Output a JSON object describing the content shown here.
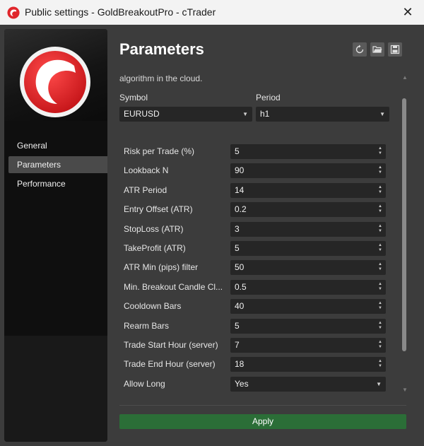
{
  "window": {
    "title": "Public settings - GoldBreakoutPro - cTrader",
    "close_glyph": "✕",
    "logo_icon": "ctrader-logo-icon"
  },
  "sidebar": {
    "items": [
      {
        "label": "General",
        "active": false
      },
      {
        "label": "Parameters",
        "active": true
      },
      {
        "label": "Performance",
        "active": false
      }
    ]
  },
  "main": {
    "title": "Parameters",
    "toolbar": {
      "icons": [
        "reset-icon",
        "open-folder-icon",
        "save-icon"
      ]
    },
    "partial_text": "algorithm in the cloud.",
    "symbol": {
      "label": "Symbol",
      "value": "EURUSD"
    },
    "period": {
      "label": "Period",
      "value": "h1"
    },
    "params": [
      {
        "label": "Risk per Trade (%)",
        "value": "5",
        "type": "number"
      },
      {
        "label": "Lookback N",
        "value": "90",
        "type": "number"
      },
      {
        "label": "ATR Period",
        "value": "14",
        "type": "number"
      },
      {
        "label": "Entry Offset (ATR)",
        "value": "0.2",
        "type": "number"
      },
      {
        "label": "StopLoss (ATR)",
        "value": "3",
        "type": "number"
      },
      {
        "label": "TakeProfit (ATR)",
        "value": "5",
        "type": "number"
      },
      {
        "label": "ATR Min (pips) filter",
        "value": "50",
        "type": "number"
      },
      {
        "label": "Min. Breakout Candle Cl...",
        "value": "0.5",
        "type": "number"
      },
      {
        "label": "Cooldown Bars",
        "value": "40",
        "type": "number"
      },
      {
        "label": "Rearm Bars",
        "value": "5",
        "type": "number"
      },
      {
        "label": "Trade Start Hour (server)",
        "value": "7",
        "type": "number"
      },
      {
        "label": "Trade End Hour (server)",
        "value": "18",
        "type": "number"
      },
      {
        "label": "Allow Long",
        "value": "Yes",
        "type": "select"
      }
    ],
    "apply_label": "Apply"
  },
  "colors": {
    "accent_green": "#2b6e37",
    "brand_red": "#e0262b",
    "panel_bg": "#3c3c3c",
    "field_bg": "#262626"
  }
}
